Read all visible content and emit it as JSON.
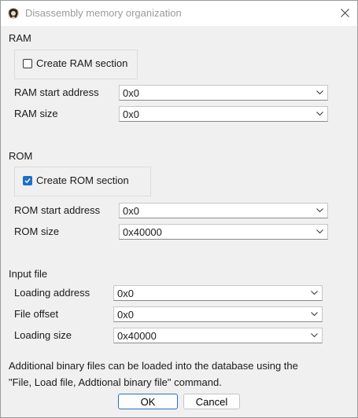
{
  "window": {
    "title": "Disassembly memory organization",
    "app_icon": "ida-icon",
    "close_icon": "close-icon"
  },
  "ram": {
    "section_label": "RAM",
    "create_checkbox": {
      "label": "Create RAM section",
      "checked": false
    },
    "start_address": {
      "label": "RAM start address",
      "value": "0x0"
    },
    "size": {
      "label": "RAM size",
      "value": "0x0"
    }
  },
  "rom": {
    "section_label": "ROM",
    "create_checkbox": {
      "label": "Create ROM section",
      "checked": true
    },
    "start_address": {
      "label": "ROM start address",
      "value": "0x0"
    },
    "size": {
      "label": "ROM size",
      "value": "0x40000"
    }
  },
  "input_file": {
    "section_label": "Input file",
    "loading_address": {
      "label": "Loading address",
      "value": "0x0"
    },
    "file_offset": {
      "label": "File offset",
      "value": "0x0"
    },
    "loading_size": {
      "label": "Loading size",
      "value": "0x40000"
    }
  },
  "note": {
    "line1": "Additional binary files can be loaded into the database using the",
    "line2": "\"File, Load file, Addtional binary file\" command."
  },
  "buttons": {
    "ok": "OK",
    "cancel": "Cancel"
  },
  "colors": {
    "accent": "#1f6fc4",
    "dialog_bg": "#f0f0f0"
  }
}
